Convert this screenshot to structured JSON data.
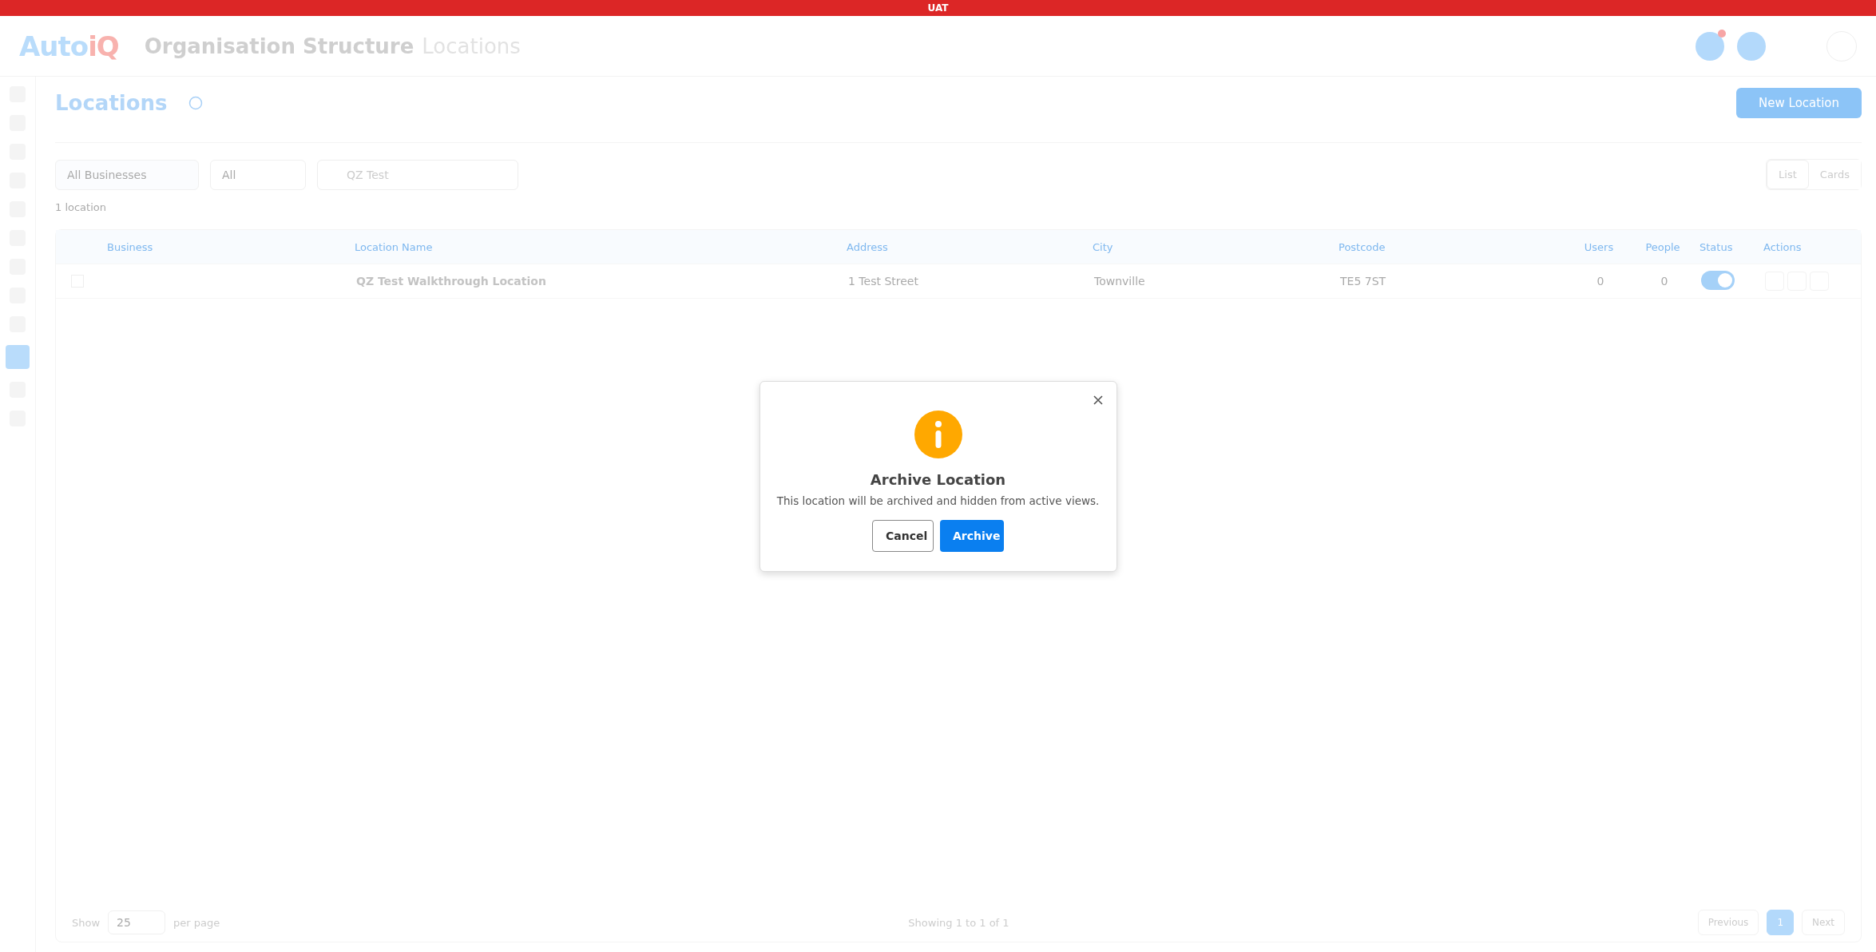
{
  "env_banner": "UAT",
  "header": {
    "logo_left": "Auto",
    "logo_right": "iQ",
    "title": "Organisation Structure",
    "subtitle": "Locations"
  },
  "sidebar": {
    "items": [
      {
        "selected": false
      },
      {
        "selected": false
      },
      {
        "selected": false
      },
      {
        "selected": false
      },
      {
        "selected": false
      },
      {
        "selected": false
      },
      {
        "selected": false
      },
      {
        "selected": false
      },
      {
        "selected": false
      },
      {
        "selected": true
      },
      {
        "selected": false
      },
      {
        "selected": false
      }
    ]
  },
  "page": {
    "title": "Locations",
    "new_button": "New Location"
  },
  "filters": {
    "business": "All Businesses",
    "status": "All",
    "search": "QZ Test",
    "count": "1 location"
  },
  "view_toggle": [
    {
      "label": "List",
      "selected": true
    },
    {
      "label": "Cards",
      "selected": false
    }
  ],
  "table": {
    "columns": [
      "Business",
      "Location Name",
      "Address",
      "City",
      "Postcode",
      "Users",
      "People",
      "Status",
      "Actions"
    ],
    "rows": [
      {
        "checked": false,
        "location": "QZ Test Walkthrough Location",
        "address": "1 Test Street",
        "city": "Townville",
        "postcode": "TE5 7ST",
        "users": "0",
        "people": "0",
        "active": true
      }
    ]
  },
  "pagination": {
    "show": "Show",
    "per_page_value": "25",
    "per_page": "per page",
    "summary": "Showing 1 to 1 of 1",
    "previous": "Previous",
    "page": "1",
    "next": "Next"
  },
  "dialog": {
    "title": "Archive Location",
    "message": "This location will be archived and hidden from active views.",
    "cancel": "Cancel",
    "confirm": "Archive"
  }
}
